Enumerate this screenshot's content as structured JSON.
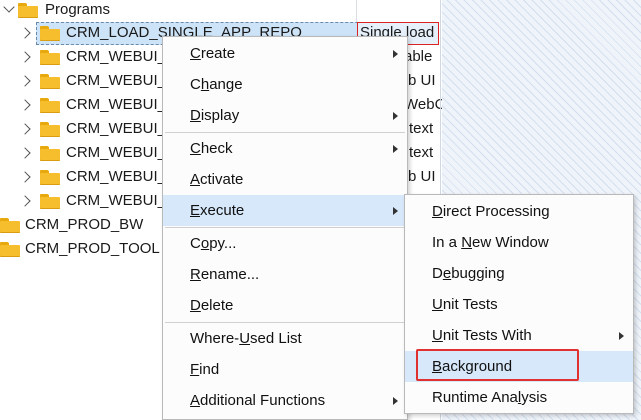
{
  "tree": {
    "programs_label": "Programs",
    "rows": [
      {
        "name": "CRM_LOAD_SINGLE_APP_REPO",
        "desc": "Single load"
      },
      {
        "name": "CRM_WEBUI_",
        "desc": "able"
      },
      {
        "name": "CRM_WEBUI_",
        "desc": "b UI"
      },
      {
        "name": "CRM_WEBUI_",
        "desc": "WebC"
      },
      {
        "name": "CRM_WEBUI_",
        "desc": "text"
      },
      {
        "name": "CRM_WEBUI_",
        "desc": "text"
      },
      {
        "name": "CRM_WEBUI_",
        "desc": "b UI"
      },
      {
        "name": "CRM_WEBUI_",
        "desc": ""
      }
    ],
    "top_level": [
      {
        "name": "CRM_PROD_BW"
      },
      {
        "name": "CRM_PROD_TOOL"
      }
    ]
  },
  "context_menu": {
    "items": [
      {
        "pre": "",
        "u": "C",
        "post": "reate",
        "submenu": true
      },
      {
        "pre": "C",
        "u": "h",
        "post": "ange",
        "submenu": false
      },
      {
        "pre": "",
        "u": "D",
        "post": "isplay",
        "submenu": true
      },
      {
        "pre": "",
        "u": "C",
        "post": "heck",
        "submenu": true
      },
      {
        "pre": "",
        "u": "A",
        "post": "ctivate",
        "submenu": false
      },
      {
        "pre": "",
        "u": "E",
        "post": "xecute",
        "submenu": true
      },
      {
        "pre": "C",
        "u": "o",
        "post": "py...",
        "submenu": false
      },
      {
        "pre": "",
        "u": "R",
        "post": "ename...",
        "submenu": false
      },
      {
        "pre": "",
        "u": "D",
        "post": "elete",
        "submenu": false
      },
      {
        "pre": "Where-",
        "u": "U",
        "post": "sed List",
        "submenu": false
      },
      {
        "pre": "",
        "u": "F",
        "post": "ind",
        "submenu": false
      },
      {
        "pre": "",
        "u": "A",
        "post": "dditional Functions",
        "submenu": true
      }
    ]
  },
  "execute_submenu": {
    "items": [
      {
        "pre": "",
        "u": "D",
        "post": "irect Processing",
        "submenu": false
      },
      {
        "pre": "In a ",
        "u": "N",
        "post": "ew Window",
        "submenu": false
      },
      {
        "pre": "D",
        "u": "e",
        "post": "bugging",
        "submenu": false
      },
      {
        "pre": "",
        "u": "U",
        "post": "nit Tests",
        "submenu": false
      },
      {
        "pre": "",
        "u": "U",
        "post": "nit Tests With",
        "submenu": true
      },
      {
        "pre": "",
        "u": "B",
        "post": "ackground",
        "submenu": false
      },
      {
        "pre": "Runtime Ana",
        "u": "l",
        "post": "ysis",
        "submenu": false
      }
    ]
  },
  "colors": {
    "highlight": "#d6e8fa",
    "selection": "#cde3f7",
    "folder": "#f6be2c",
    "annotation_box": "#e03030"
  }
}
